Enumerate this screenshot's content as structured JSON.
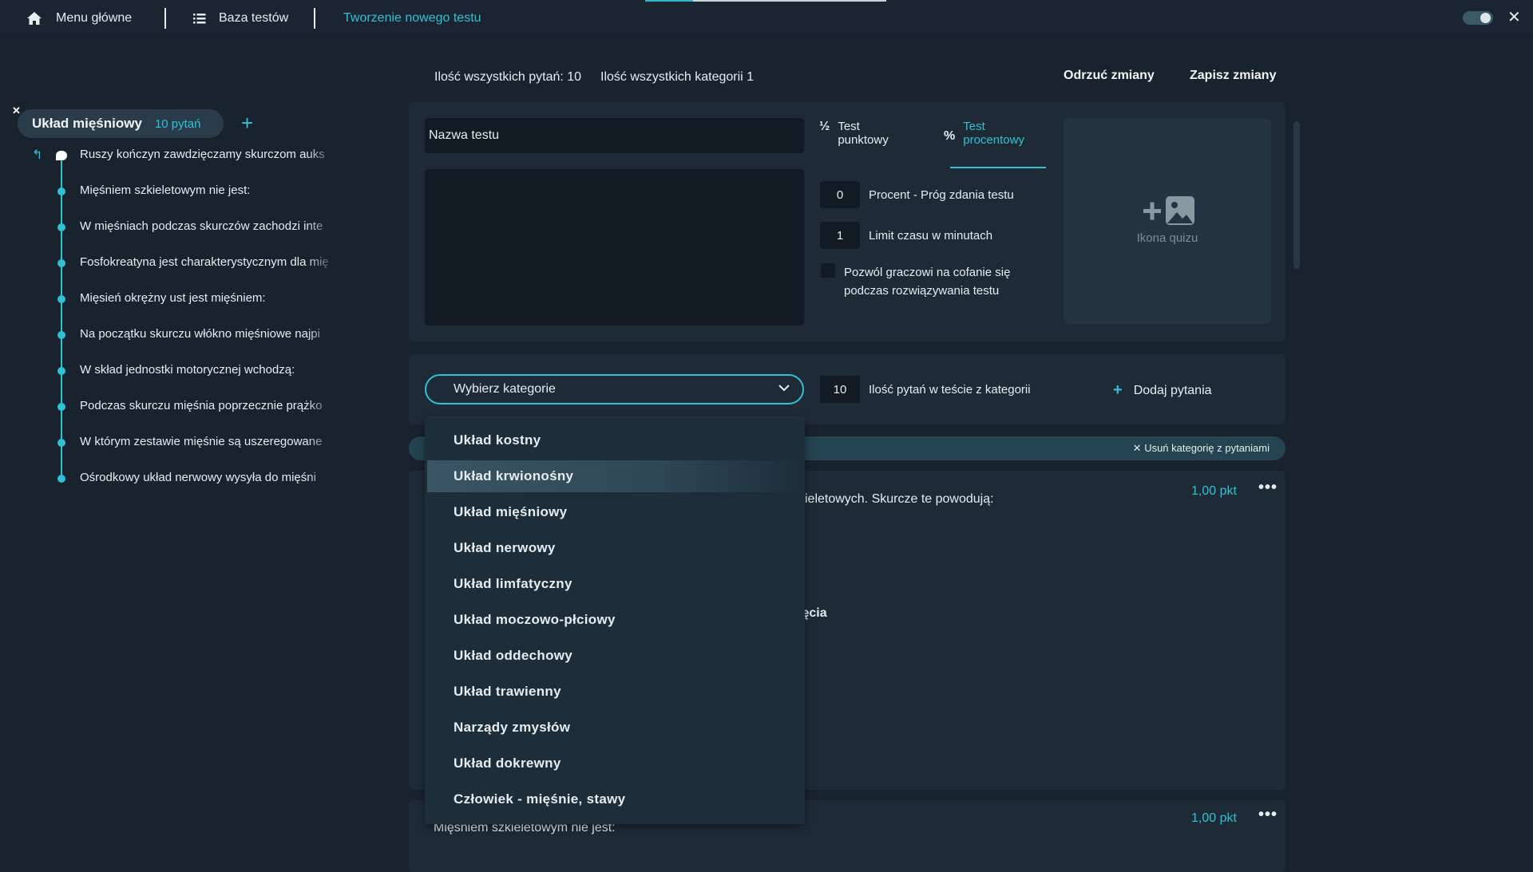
{
  "nav": {
    "home_label": "Menu główne",
    "tests_label": "Baza testów",
    "current_label": "Tworzenie nowego testu"
  },
  "header": {
    "questions_count": "Ilość wszystkich pytań: 10",
    "categories_count": "Ilość wszystkich kategorii 1",
    "discard_label": "Odrzuć zmiany",
    "save_label": "Zapisz zmiany"
  },
  "sidebar": {
    "category_name": "Układ mięśniowy",
    "category_count": "10 pytań",
    "items": [
      "Ruszy kończyn zawdzięczamy skurczom auks",
      "Mięśniem szkieletowym nie jest:",
      "W mięśniach podczas skurczów zachodzi inte",
      "Fosfokreatyna jest charakterystycznym dla mię",
      "Mięsień okrężny ust jest mięśniem:",
      "Na początku skurczu włókno mięśniowe najpi",
      "W skład jednostki motorycznej wchodzą:",
      "Podczas skurczu mięśnia poprzecznie prążko",
      "W którym zestawie mięśnie są uszeregowane",
      "Ośrodkowy układ nerwowy wysyła do mięśni"
    ]
  },
  "test_form": {
    "name_placeholder": "Nazwa testu",
    "tab_points_sym": "½",
    "tab_points_line1": "Test",
    "tab_points_line2": "punktowy",
    "tab_percent_sym": "%",
    "tab_percent_line1": "Test",
    "tab_percent_line2": "procentowy",
    "threshold_value": "0",
    "threshold_label": "Procent - Próg zdania testu",
    "time_value": "1",
    "time_label": "Limit czasu w minutach",
    "allow_back_line1": "Pozwól graczowi na cofanie się",
    "allow_back_line2": "podczas rozwiązywania testu",
    "icon_label": "Ikona quizu"
  },
  "category_select": {
    "placeholder": "Wybierz kategorie",
    "count_value": "10",
    "count_label": "Ilość pytań w teście z kategorii",
    "add_label": "Dodaj pytania",
    "remove_label": "Usuń kategorię z pytaniami"
  },
  "dropdown": {
    "options": [
      "Układ kostny",
      "Układ krwionośny",
      "Układ mięśniowy",
      "Układ nerwowy",
      "Układ limfatyczny",
      "Układ moczowo-płciowy",
      "Układ oddechowy",
      "Układ trawienny",
      "Narządy zmysłów",
      "Układ dokrewny",
      "Człowiek - mięśnie, stawy"
    ],
    "highlighted_index": 1
  },
  "questions": [
    {
      "partial_text": "kieletowych. Skurcze te powodują:",
      "partial_text2": "ięcia",
      "points": "1,00 pkt"
    },
    {
      "text": "Mięśniem szkieletowym nie jest:",
      "points": "1,00 pkt"
    }
  ],
  "colors": {
    "accent": "#2fc1d5",
    "background": "#19232e",
    "panel": "#1e2b37",
    "input": "#121b24"
  }
}
